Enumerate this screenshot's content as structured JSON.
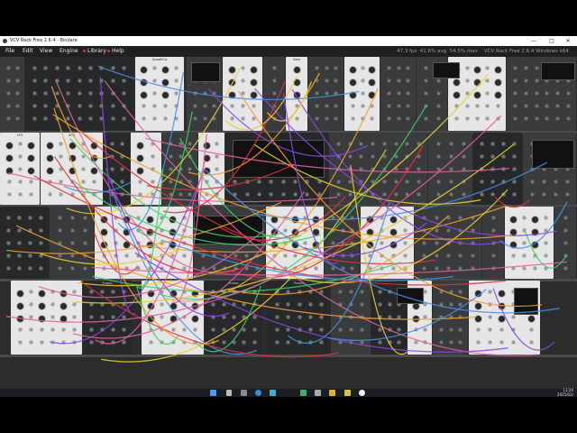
{
  "window": {
    "title": "VCV Rack Free 2.6.4 - Bindare",
    "minimize": "—",
    "maximize": "□",
    "close": "✕"
  },
  "menu": {
    "file": "File",
    "edit": "Edit",
    "view": "View",
    "engine": "Engine",
    "library": "Library",
    "help": "Help"
  },
  "stats": {
    "fps": "47.3 fps",
    "avg": "41.6% avg",
    "max": "54.5% max",
    "edition": "VCV Rack Free 2.6.4 Windows x64"
  },
  "modules": {
    "quadvca_label": "QuadVCA",
    "gain_label": "Gain",
    "pulses_label": "Pulses",
    "lfo_label": "LFO",
    "vco_label": "VCO"
  },
  "colors": {
    "cable_green": "#3fd06a",
    "cable_purple": "#8b46e0",
    "cable_orange": "#f0a030",
    "cable_red": "#e03040",
    "cable_pink": "#e060a0",
    "cable_blue": "#4a8fe0",
    "cable_yellow": "#e8d030",
    "light_panel": "#e6e6e6",
    "dark_panel": "#3a3b3d"
  },
  "taskbar": {
    "time": "13:20",
    "date": "2025/02/"
  },
  "icons": [
    "windows-start-icon",
    "search-icon",
    "task-view-icon",
    "edge-icon",
    "file-explorer-icon",
    "vcv-rack-icon"
  ]
}
